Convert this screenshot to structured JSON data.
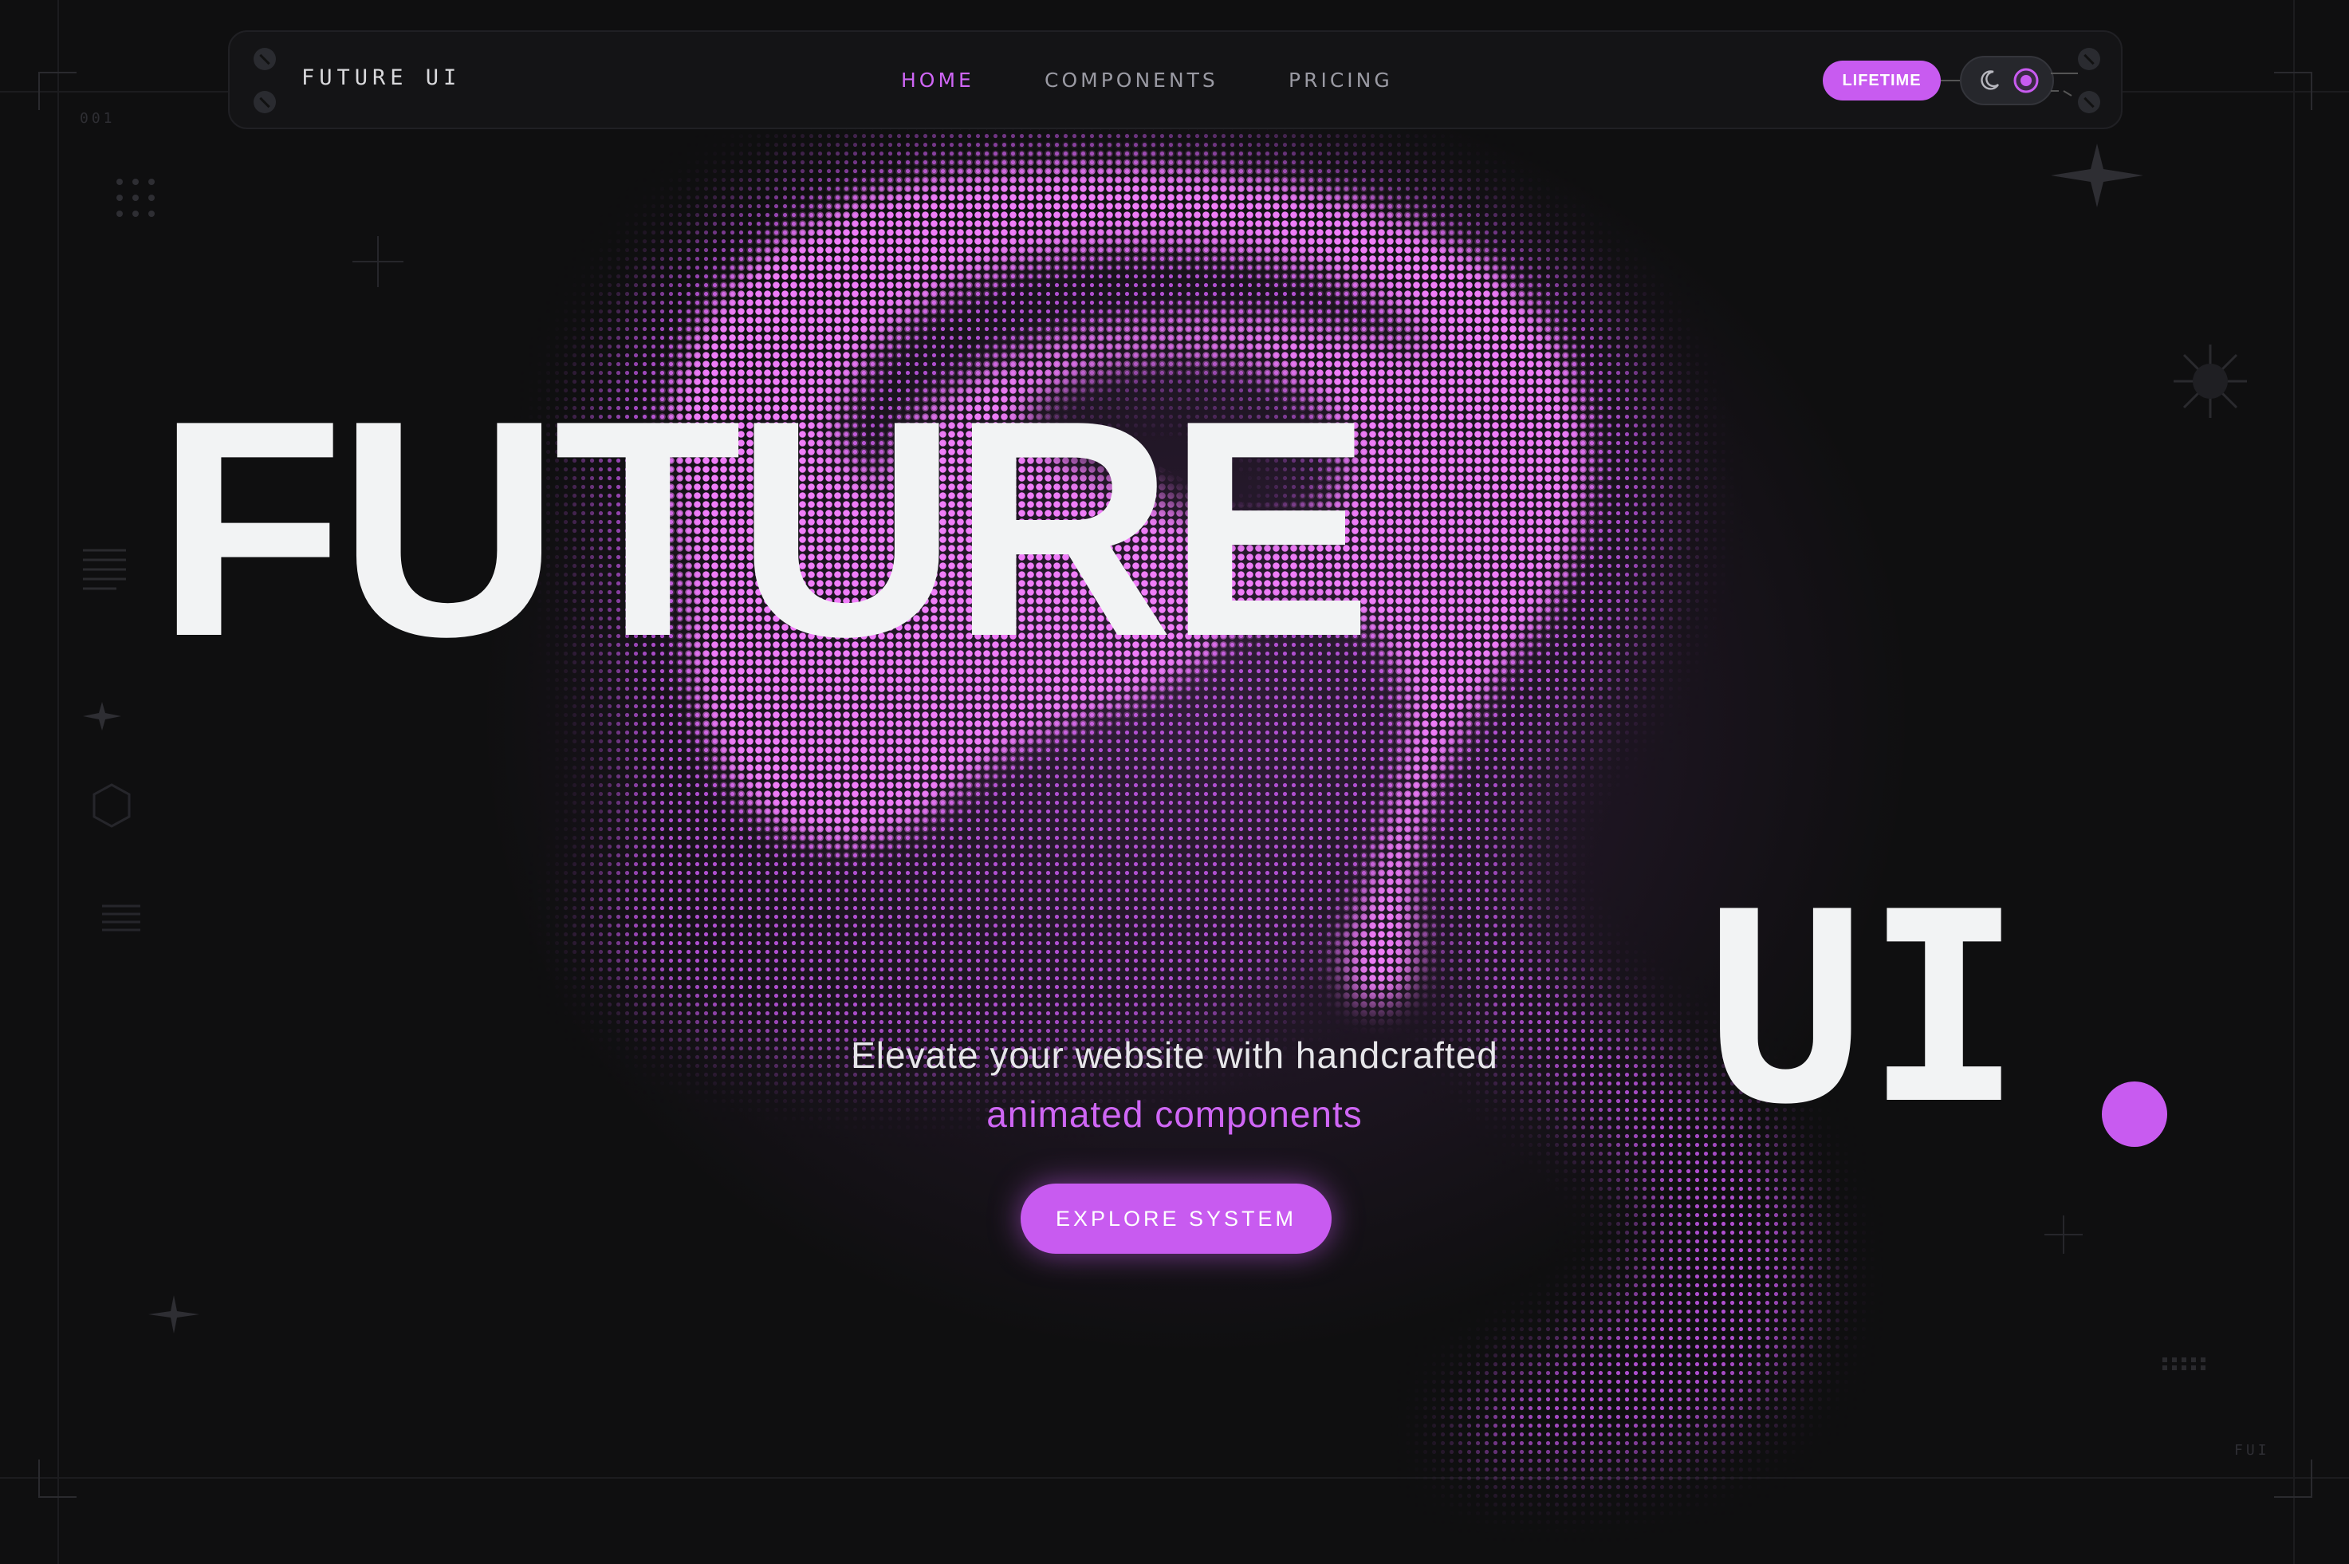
{
  "nav": {
    "brand": "FUTURE UI",
    "links": [
      {
        "label": "HOME",
        "active": true
      },
      {
        "label": "COMPONENTS",
        "active": false
      },
      {
        "label": "PRICING",
        "active": false
      }
    ],
    "badge": "LIFETIME"
  },
  "hero": {
    "word_one": "FUTURE",
    "word_two": "UI",
    "tagline": "Elevate your website with handcrafted",
    "tagline_accent": "animated components",
    "cta": "EXPLORE SYSTEM"
  },
  "decor": {
    "code_left": "001",
    "code_right": "FUI"
  },
  "colors": {
    "background": "#0f0f10",
    "accent": "#c85bf0",
    "text": "#f2f3f4"
  },
  "icons": {
    "theme_moon": "moon-icon",
    "theme_active": "target-icon"
  }
}
